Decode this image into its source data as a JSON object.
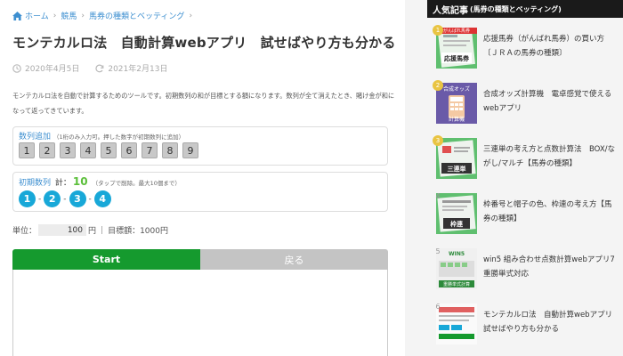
{
  "breadcrumb": {
    "items": [
      "ホーム",
      "競馬",
      "馬券の種類とベッティング"
    ]
  },
  "article": {
    "title": "モンテカルロ法　自動計算webアプリ　試せばやり方も分かる",
    "published": "2020年4月5日",
    "updated": "2021年2月13日",
    "description": "モンテカルロ法を自動で計算するためのツールです。初期数列の和が目標とする額になります。数列が全て消えたとき、賭け金が和になって返ってきています。"
  },
  "calculator": {
    "add_label": "数列追加",
    "add_note": "（1桁のみ入力可。押した数字が初期数列に追加）",
    "number_buttons": [
      "1",
      "2",
      "3",
      "4",
      "5",
      "6",
      "7",
      "8",
      "9"
    ],
    "initial_label": "初期数列",
    "total_prefix": "計：",
    "total_value": "10",
    "initial_note": "（タップで削除。最大10個まで）",
    "initial_sequence": [
      "1",
      "2",
      "3",
      "4"
    ],
    "separator": "-",
    "unit_label": "単位：",
    "unit_value": "100",
    "unit_suffix": "円",
    "target_text": "目標額：1000円",
    "start_label": "Start",
    "back_label": "戻る"
  },
  "sidebar": {
    "heading": "人気記事",
    "heading_sub": "(馬券の種類とベッティング)",
    "items": [
      {
        "rank": "1",
        "title": "応援馬券（がんばれ馬券）の買い方〔ＪＲＡの馬券の種類〕",
        "thumb_caption": "応援馬券",
        "thumb_top": "がんばれ馬券"
      },
      {
        "rank": "2",
        "title": "合成オッズ計算機　電卓感覚で使えるwebアプリ",
        "thumb_caption": "計算機",
        "thumb_top": "合成オッズ"
      },
      {
        "rank": "3",
        "title": "三連単の考え方と点数計算法　BOX/ながし/マルチ【馬券の種類】",
        "thumb_caption": "三連単"
      },
      {
        "rank": "4",
        "title": "枠番号と帽子の色、枠連の考え方【馬券の種類】",
        "thumb_caption": "枠連"
      },
      {
        "rank": "5",
        "title": "win5 組み合わせ点数計算webアプリ7重勝単式対応",
        "thumb_caption": "重勝単式計算",
        "thumb_top": "WIN5"
      },
      {
        "rank": "6",
        "title": "モンテカルロ法　自動計算webアプリ　試せばやり方も分かる"
      }
    ]
  },
  "colors": {
    "link": "#3d8fd0",
    "start_button": "#159a2e",
    "back_button": "#c4c4c4",
    "sequence_chip": "#18a8d8",
    "total_value": "#5bbf3a",
    "rank_gold": "#e9c442",
    "sidebar_header": "#1a1a1a"
  }
}
